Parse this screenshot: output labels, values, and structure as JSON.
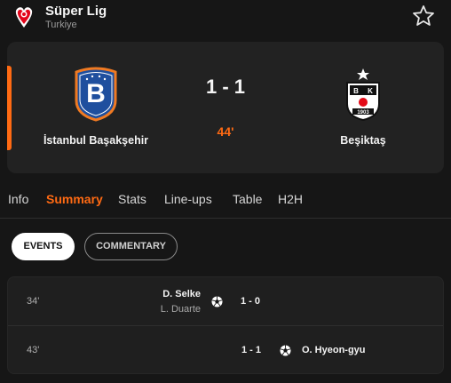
{
  "header": {
    "league_logo_icon": "superlig-logo-icon",
    "league_name": "Süper Lig",
    "country": "Turkiye",
    "favorite_icon": "star-outline-icon"
  },
  "match": {
    "home_team": "İstanbul Başakşehir",
    "away_team": "Beşiktaş",
    "score": "1 - 1",
    "minute": "44'",
    "home_crest_icon": "basaksehir-crest-icon",
    "away_crest_icon": "besiktas-crest-icon",
    "live": true
  },
  "tabs": [
    "Info",
    "Summary",
    "Stats",
    "Line-ups",
    "Table",
    "H2H"
  ],
  "active_tab": "Summary",
  "filters": {
    "events": "EVENTS",
    "commentary": "COMMENTARY",
    "active": "EVENTS"
  },
  "events": [
    {
      "minute": "34'",
      "side": "home",
      "player": "D. Selke",
      "assist": "L. Duarte",
      "score": "1 - 0",
      "icon": "soccer-ball-icon"
    },
    {
      "minute": "43'",
      "side": "away",
      "player": "O. Hyeon-gyu",
      "assist": "",
      "score": "1 - 1",
      "icon": "soccer-ball-icon"
    }
  ],
  "colors": {
    "accent": "#ff6a13",
    "background": "#161616",
    "card": "#222222",
    "home_blue": "#1f4f9e",
    "home_orange": "#f07a22"
  }
}
